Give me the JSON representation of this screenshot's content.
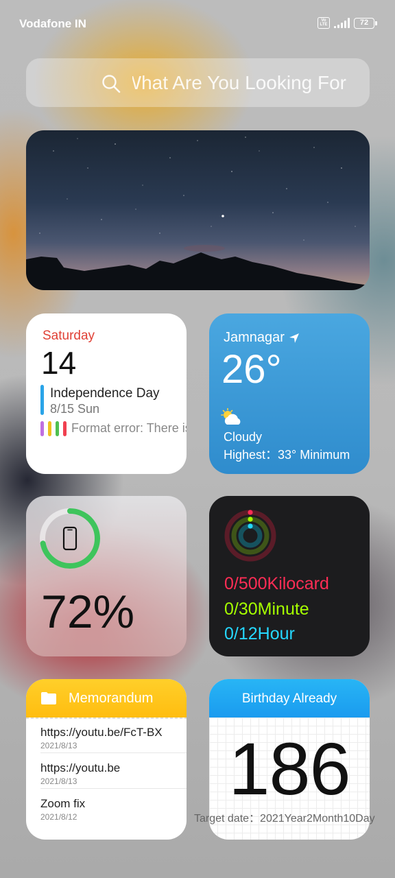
{
  "status_bar": {
    "carrier": "Vodafone IN",
    "volte_label": "Vo LTE",
    "battery": "72"
  },
  "search": {
    "placeholder": "What Are You Looking For"
  },
  "calendar": {
    "weekday": "Saturday",
    "day": "14",
    "event_title": "Independence Day",
    "event_date": "8/15 Sun",
    "error_text": "Format error: There is already",
    "dot_colors": [
      "#c070e0",
      "#f0c020",
      "#50c050",
      "#f04050"
    ]
  },
  "weather": {
    "city": "Jamnagar",
    "temperature": "26°",
    "condition": "Cloudy",
    "range": "Highest：33° Minimum",
    "icon": "partly-cloudy-icon"
  },
  "battery_widget": {
    "percent_label": "72%",
    "level": 0.72,
    "ring_color": "#3ec45c"
  },
  "activity": {
    "move": "0/500Kilocard",
    "exercise": "0/30Minute",
    "stand": "0/12Hour",
    "colors": {
      "move": "#ff2d55",
      "exercise": "#a6ff00",
      "stand": "#25d8ff"
    }
  },
  "memorandum": {
    "title": "Memorandum",
    "items": [
      {
        "text": "https://youtu.be/FcT-BX",
        "date": "2021/8/13"
      },
      {
        "text": "https://youtu.be",
        "date": "2021/8/13"
      },
      {
        "text": "Zoom fix",
        "date": "2021/8/12"
      }
    ]
  },
  "birthday": {
    "header": "Birthday Already",
    "days": "186",
    "target": "Target date：2021Year2Month10Day"
  }
}
